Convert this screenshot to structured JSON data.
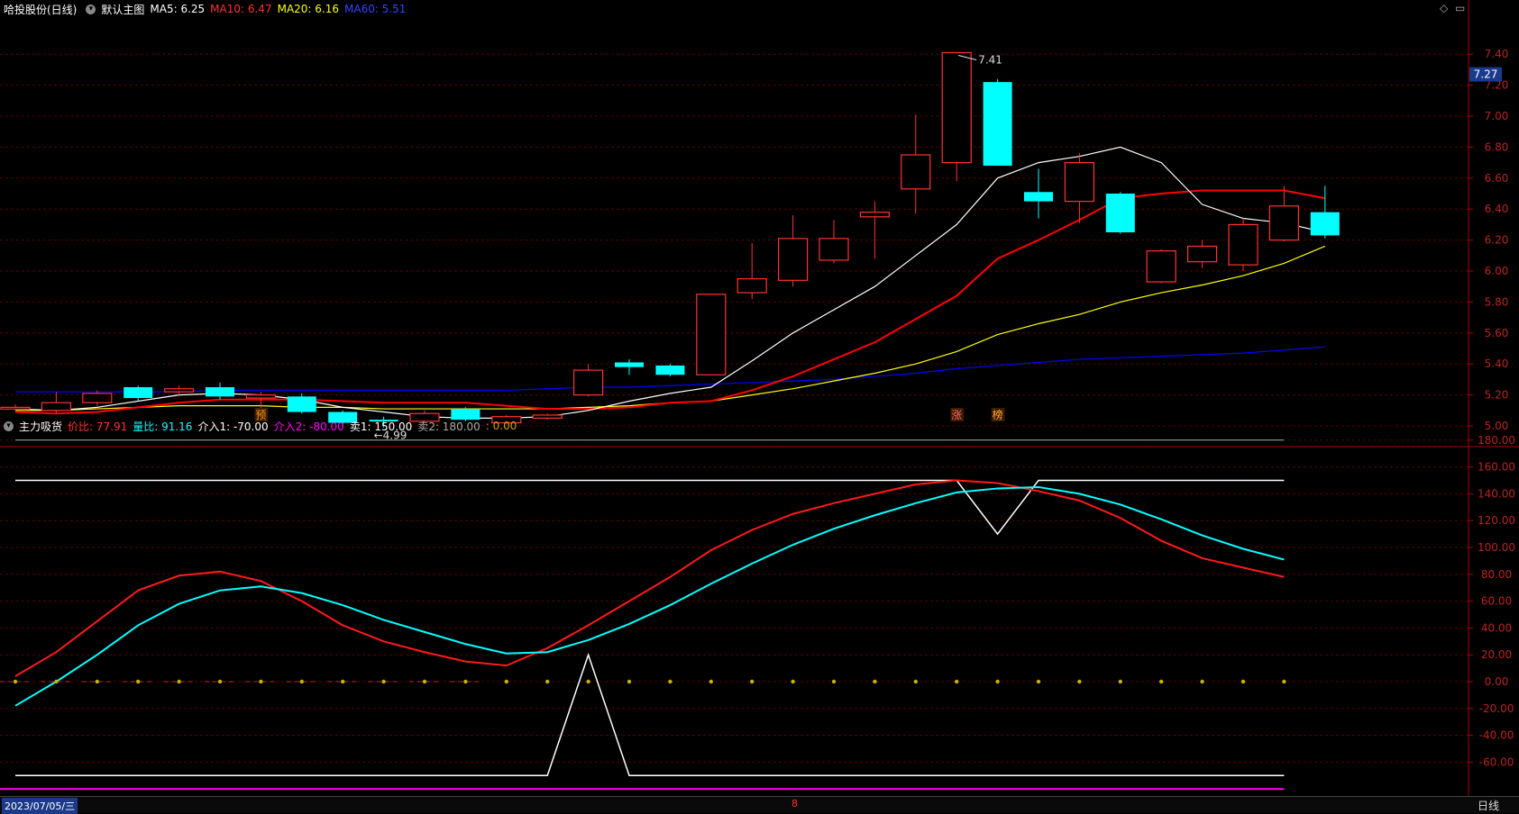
{
  "header1": {
    "stock": "哈投股份(日线)",
    "template": "默认主图",
    "ma5": "MA5: 6.25",
    "ma10": "MA10: 6.47",
    "ma20": "MA20: 6.16",
    "ma60": "MA60: 5.51"
  },
  "header2": {
    "indicator": "主力吸货",
    "jiabi": "价比: 77.91",
    "liangbi": "量比: 91.16",
    "jieru1": "介入1: -70.00",
    "jieru2": "介入2: -80.00",
    "mai1": "卖1: 150.00",
    "mai2": "卖2: 180.00",
    "extra": ": 0.00"
  },
  "price_axis": [
    "7.40",
    "7.20",
    "7.00",
    "6.80",
    "6.60",
    "6.40",
    "6.20",
    "6.00",
    "5.80",
    "5.60",
    "5.40",
    "5.20",
    "5.00"
  ],
  "current_price": "7.27",
  "indicator_axis": [
    "180.00",
    "160.00",
    "140.00",
    "120.00",
    "100.00",
    "80.00",
    "60.00",
    "40.00",
    "20.00",
    "0.00",
    "-20.00",
    "-40.00",
    "-60.00"
  ],
  "annotations": {
    "high": "7.41",
    "low": "4.99",
    "m1": "预",
    "m2": "涨",
    "m3": "榜"
  },
  "bottom": {
    "date": "2023/07/05/三",
    "tab": "日线",
    "mark": "8"
  },
  "colors": {
    "up": "#ff3232",
    "down": "#00ffff",
    "ma5": "#ffffff",
    "ma10": "#ff0000",
    "ma20": "#ffff00",
    "ma60": "#0000ff"
  },
  "chart_data": {
    "type": "candlestick",
    "candles": [
      {
        "o": 5.12,
        "c": 5.12,
        "h": 5.14,
        "l": 5.1
      },
      {
        "o": 5.1,
        "c": 5.15,
        "h": 5.22,
        "l": 5.08
      },
      {
        "o": 5.15,
        "c": 5.21,
        "h": 5.23,
        "l": 5.13
      },
      {
        "o": 5.25,
        "c": 5.18,
        "h": 5.26,
        "l": 5.16
      },
      {
        "o": 5.22,
        "c": 5.24,
        "h": 5.26,
        "l": 5.19
      },
      {
        "o": 5.25,
        "c": 5.19,
        "h": 5.28,
        "l": 5.17
      },
      {
        "o": 5.18,
        "c": 5.2,
        "h": 5.22,
        "l": 5.07
      },
      {
        "o": 5.19,
        "c": 5.09,
        "h": 5.21,
        "l": 5.08
      },
      {
        "o": 5.09,
        "c": 5.02,
        "h": 5.1,
        "l": 5.0
      },
      {
        "o": 5.04,
        "c": 5.03,
        "h": 5.06,
        "l": 4.99
      },
      {
        "o": 5.03,
        "c": 5.08,
        "h": 5.1,
        "l": 5.02
      },
      {
        "o": 5.11,
        "c": 5.04,
        "h": 5.12,
        "l": 5.03
      },
      {
        "o": 5.02,
        "c": 5.06,
        "h": 5.07,
        "l": 5.01
      },
      {
        "o": 5.05,
        "c": 5.07,
        "h": 5.08,
        "l": 5.04
      },
      {
        "o": 5.2,
        "c": 5.36,
        "h": 5.4,
        "l": 5.19
      },
      {
        "o": 5.41,
        "c": 5.38,
        "h": 5.43,
        "l": 5.33
      },
      {
        "o": 5.39,
        "c": 5.33,
        "h": 5.4,
        "l": 5.32
      },
      {
        "o": 5.33,
        "c": 5.85,
        "h": 5.85,
        "l": 5.33
      },
      {
        "o": 5.86,
        "c": 5.95,
        "h": 6.18,
        "l": 5.82
      },
      {
        "o": 5.94,
        "c": 6.21,
        "h": 6.36,
        "l": 5.9
      },
      {
        "o": 6.07,
        "c": 6.21,
        "h": 6.33,
        "l": 6.05
      },
      {
        "o": 6.35,
        "c": 6.38,
        "h": 6.45,
        "l": 6.08
      },
      {
        "o": 6.53,
        "c": 6.75,
        "h": 7.01,
        "l": 6.37
      },
      {
        "o": 6.7,
        "c": 7.41,
        "h": 7.41,
        "l": 6.58
      },
      {
        "o": 7.22,
        "c": 6.68,
        "h": 7.24,
        "l": 6.68
      },
      {
        "o": 6.51,
        "c": 6.45,
        "h": 6.66,
        "l": 6.34
      },
      {
        "o": 6.45,
        "c": 6.7,
        "h": 6.76,
        "l": 6.31
      },
      {
        "o": 6.5,
        "c": 6.25,
        "h": 6.51,
        "l": 6.24
      },
      {
        "o": 5.93,
        "c": 6.13,
        "h": 6.14,
        "l": 5.92
      },
      {
        "o": 6.06,
        "c": 6.16,
        "h": 6.2,
        "l": 6.02
      },
      {
        "o": 6.04,
        "c": 6.3,
        "h": 6.34,
        "l": 6.0
      },
      {
        "o": 6.2,
        "c": 6.42,
        "h": 6.55,
        "l": 6.19
      },
      {
        "o": 6.38,
        "c": 6.23,
        "h": 6.55,
        "l": 6.21
      }
    ],
    "ma5": [
      5.11,
      5.1,
      5.12,
      5.16,
      5.2,
      5.21,
      5.2,
      5.17,
      5.12,
      5.09,
      5.06,
      5.05,
      5.05,
      5.06,
      5.1,
      5.16,
      5.21,
      5.25,
      5.42,
      5.6,
      5.75,
      5.9,
      6.1,
      6.3,
      6.6,
      6.7,
      6.74,
      6.8,
      6.7,
      6.43,
      6.34,
      6.31,
      6.25
    ],
    "ma10": [
      5.09,
      5.08,
      5.09,
      5.12,
      5.15,
      5.17,
      5.17,
      5.17,
      5.16,
      5.15,
      5.15,
      5.15,
      5.13,
      5.11,
      5.11,
      5.12,
      5.15,
      5.16,
      5.23,
      5.32,
      5.43,
      5.54,
      5.69,
      5.84,
      6.08,
      6.2,
      6.33,
      6.47,
      6.5,
      6.52,
      6.52,
      6.52,
      6.47
    ],
    "ma20": [
      5.1,
      5.1,
      5.11,
      5.12,
      5.13,
      5.13,
      5.13,
      5.12,
      5.12,
      5.11,
      5.11,
      5.11,
      5.11,
      5.11,
      5.12,
      5.13,
      5.15,
      5.16,
      5.2,
      5.24,
      5.29,
      5.34,
      5.4,
      5.48,
      5.59,
      5.66,
      5.72,
      5.8,
      5.86,
      5.91,
      5.97,
      6.05,
      6.16
    ],
    "ma60": [
      5.22,
      5.22,
      5.22,
      5.22,
      5.22,
      5.23,
      5.23,
      5.23,
      5.23,
      5.23,
      5.23,
      5.23,
      5.23,
      5.24,
      5.25,
      5.25,
      5.26,
      5.27,
      5.28,
      5.29,
      5.3,
      5.32,
      5.34,
      5.37,
      5.39,
      5.41,
      5.43,
      5.44,
      5.45,
      5.46,
      5.47,
      5.49,
      5.51
    ],
    "indicator": {
      "jiabi": [
        4,
        22,
        45,
        68,
        79,
        82,
        75,
        60,
        42,
        30,
        22,
        15,
        12,
        25,
        42,
        60,
        78,
        98,
        113,
        125,
        133,
        140,
        147,
        150,
        148,
        142,
        135,
        122,
        105,
        92,
        85,
        78
      ],
      "liangbi": [
        -18,
        0,
        20,
        42,
        58,
        68,
        71,
        66,
        57,
        46,
        37,
        28,
        21,
        22,
        31,
        43,
        57,
        73,
        88,
        102,
        114,
        124,
        133,
        141,
        144,
        145,
        140,
        132,
        121,
        109,
        99,
        91
      ],
      "mai_line": [
        150,
        150,
        150,
        150,
        150,
        150,
        150,
        150,
        150,
        150,
        150,
        150,
        150,
        150,
        150,
        150,
        150,
        150,
        150,
        150,
        150,
        150,
        150,
        150,
        110,
        150,
        150,
        150,
        150,
        150,
        150,
        150
      ],
      "jieru_line": [
        -70,
        -70,
        -70,
        -70,
        -70,
        -70,
        -70,
        -70,
        -70,
        -70,
        -70,
        -70,
        -70,
        -70,
        20,
        -70,
        -70,
        -70,
        -70,
        -70,
        -70,
        -70,
        -70,
        -70,
        -70,
        -70,
        -70,
        -70,
        -70,
        -70,
        -70,
        -70
      ],
      "mai2": 180,
      "jieru2": -80
    }
  }
}
